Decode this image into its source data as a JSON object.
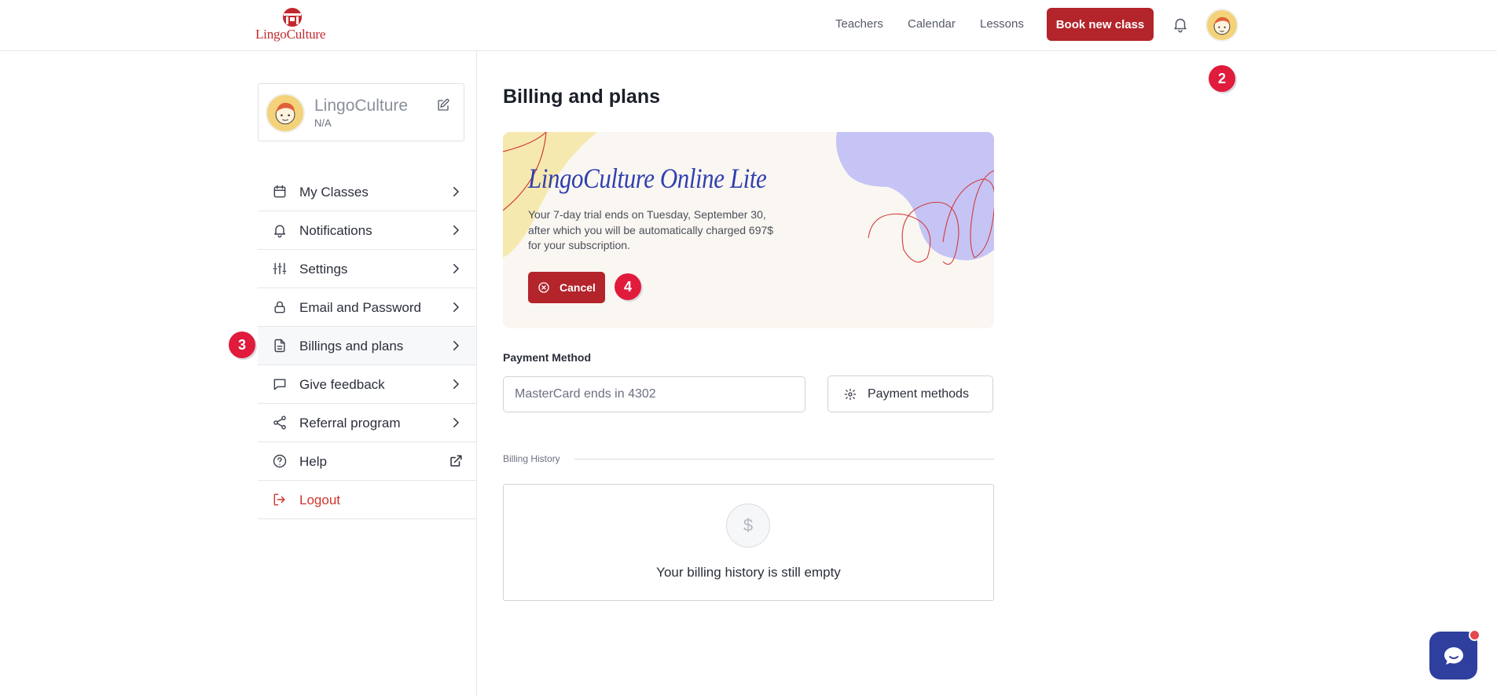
{
  "header": {
    "logo_text": "LingoCulture",
    "nav": [
      "Teachers",
      "Calendar",
      "Lessons"
    ],
    "book_button": "Book new class",
    "icons": [
      "bell-icon",
      "avatar"
    ]
  },
  "markers": {
    "m2": "2",
    "m3": "3",
    "m4": "4"
  },
  "profile": {
    "name": "LingoCulture",
    "subtitle": "N/A"
  },
  "sidebar": {
    "items": [
      {
        "label": "My Classes",
        "icon": "calendar-icon"
      },
      {
        "label": "Notifications",
        "icon": "bell-icon"
      },
      {
        "label": "Settings",
        "icon": "sliders-icon"
      },
      {
        "label": "Email and Password",
        "icon": "lock-icon"
      },
      {
        "label": "Billings and plans",
        "icon": "document-icon"
      },
      {
        "label": "Give feedback",
        "icon": "chat-bubble-icon"
      },
      {
        "label": "Referral program",
        "icon": "share-icon"
      },
      {
        "label": "Help",
        "icon": "question-icon"
      },
      {
        "label": "Logout",
        "icon": "logout-icon"
      }
    ],
    "active_index": 4
  },
  "main": {
    "title": "Billing and plans",
    "plan": {
      "name": "LingoCulture Online Lite",
      "description_lines": [
        "Your 7-day trial ends on Tuesday, September 30,",
        "after which you will be automatically charged 697$",
        "for your subscription."
      ],
      "cancel_label": "Cancel"
    },
    "payment": {
      "label": "Payment Method",
      "card_value": "MasterCard ends in 4302",
      "button_label": "Payment methods"
    },
    "history": {
      "label": "Billing History",
      "empty_text": "Your billing history is still empty",
      "icon_glyph": "$"
    }
  },
  "colors": {
    "brand_red": "#b3242b",
    "plan_title": "#2f3faf",
    "marker": "#e01b3c",
    "chat": "#2f3f9e"
  }
}
